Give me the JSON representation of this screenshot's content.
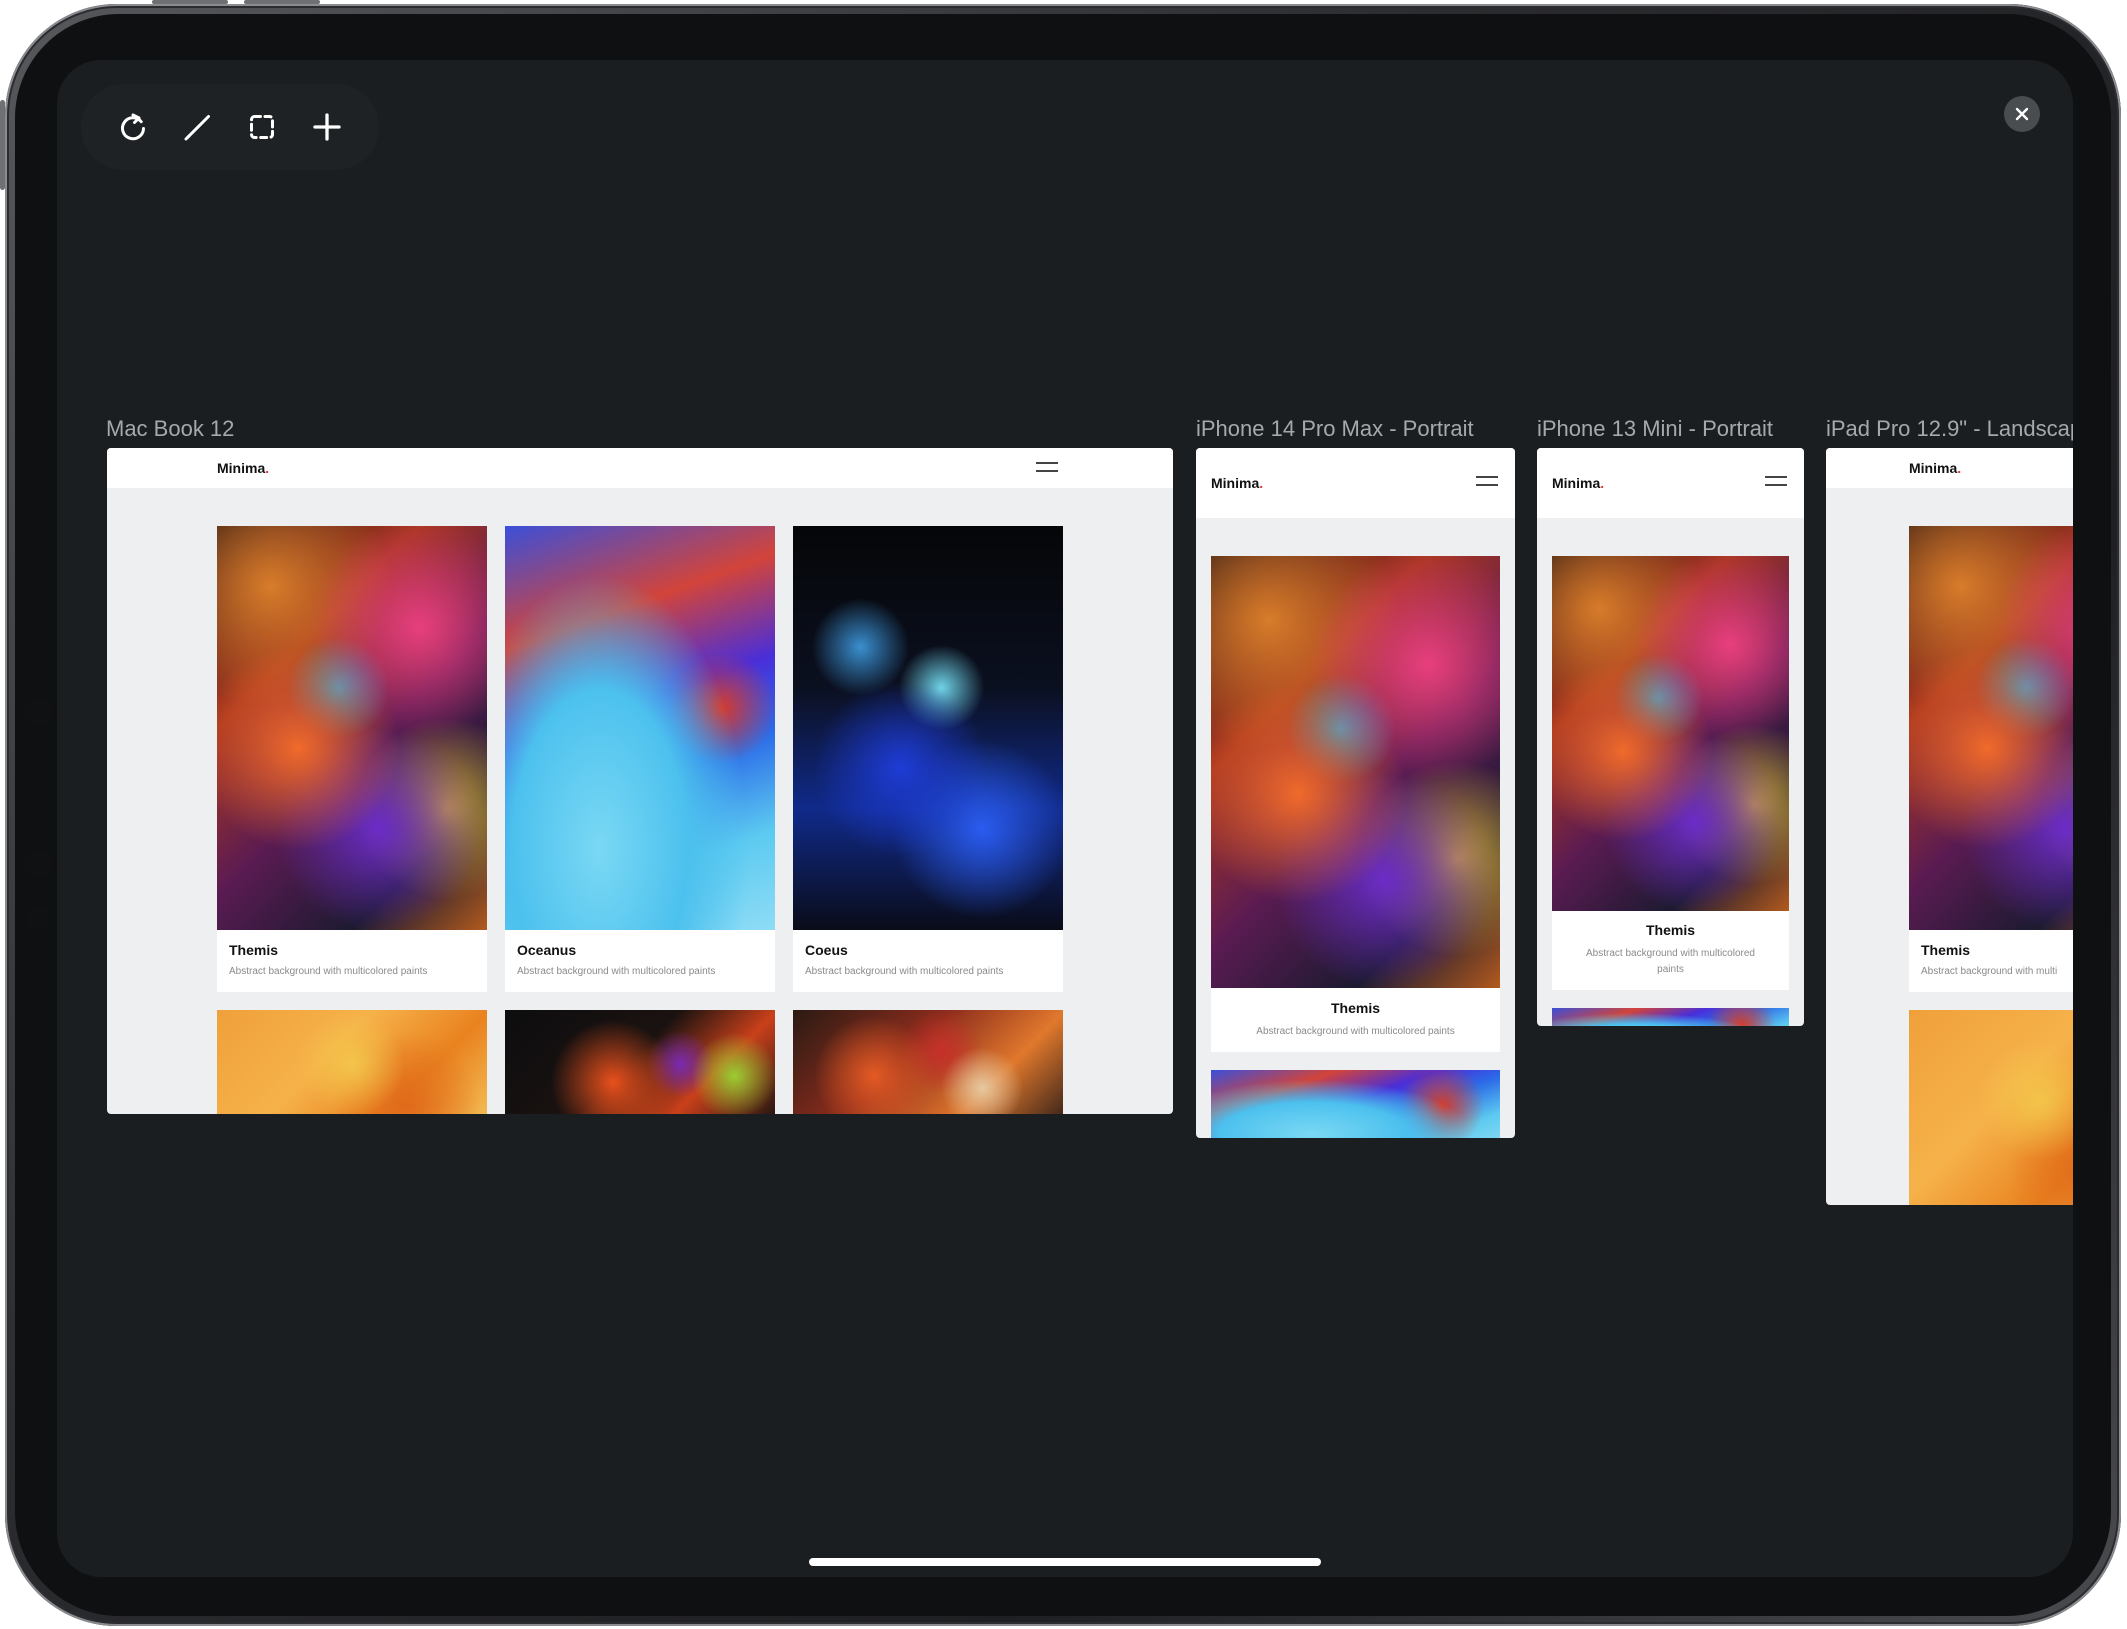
{
  "toolbar": {
    "icons": [
      "reload-icon",
      "pencil-icon",
      "selection-icon",
      "plus-icon"
    ]
  },
  "close_icon": "close-icon",
  "site": {
    "logo": "Minima",
    "logo_dot": ".",
    "logo_dot_color": "#e23a3a"
  },
  "cards": [
    {
      "title": "Themis",
      "desc": "Abstract background with multicolored paints"
    },
    {
      "title": "Oceanus",
      "desc": "Abstract background with multicolored paints"
    },
    {
      "title": "Coeus",
      "desc": "Abstract background with multicolored paints"
    }
  ],
  "panels": [
    {
      "title": "Mac Book 12"
    },
    {
      "title": "iPhone 14 Pro Max - Portrait"
    },
    {
      "title": "iPhone 13 Mini - Portrait"
    },
    {
      "title": "iPad Pro 12.9\" - Landscap"
    }
  ],
  "mini_desc_line1": "Abstract background with multicolored",
  "mini_desc_line2": "paints",
  "ipad_desc_partial": "Abstract background with multi",
  "colors": {
    "screen_bg": "#1b1e20",
    "frame_bg": "#eeeff0",
    "panel_title": "#a6a9ac"
  }
}
